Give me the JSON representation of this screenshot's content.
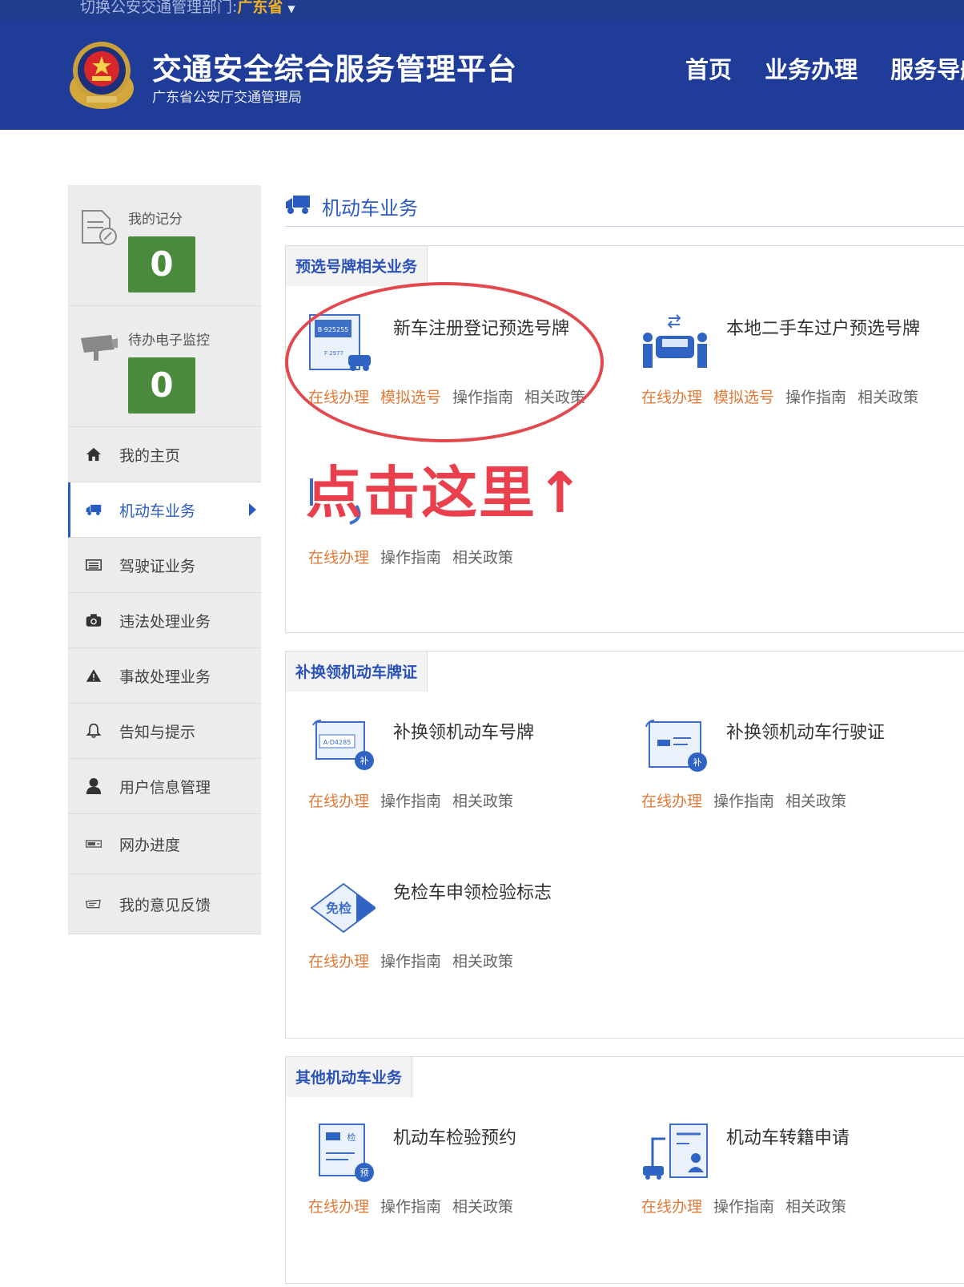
{
  "topbar": {
    "switch_label": "切换公安交通管理部门:",
    "province": "广东省"
  },
  "header": {
    "title": "交通安全综合服务管理平台",
    "subtitle": "广东省公安厅交通管理局",
    "nav": [
      "首页",
      "业务办理",
      "服务导航"
    ]
  },
  "sidebar": {
    "score_label": "我的记分",
    "score_value": "0",
    "monitor_label": "待办电子监控",
    "monitor_value": "0",
    "items": [
      {
        "label": "我的主页",
        "icon": "home-icon"
      },
      {
        "label": "机动车业务",
        "icon": "truck-icon"
      },
      {
        "label": "驾驶证业务",
        "icon": "license-icon"
      },
      {
        "label": "违法处理业务",
        "icon": "camera-icon"
      },
      {
        "label": "事故处理业务",
        "icon": "warning-icon"
      },
      {
        "label": "告知与提示",
        "icon": "bell-icon"
      },
      {
        "label": "用户信息管理",
        "icon": "user-icon"
      },
      {
        "label": "网办进度",
        "icon": "progress-icon"
      },
      {
        "label": "我的意见反馈",
        "icon": "feedback-icon"
      }
    ]
  },
  "main": {
    "title": "机动车业务",
    "sections": [
      {
        "tab": "预选号牌相关业务",
        "services": [
          {
            "name": "新车注册登记预选号牌",
            "links": [
              "在线办理",
              "模拟选号",
              "操作指南",
              "相关政策"
            ]
          },
          {
            "name": "本地二手车过户预选号牌",
            "links": [
              "在线办理",
              "模拟选号",
              "操作指南",
              "相关政策"
            ]
          },
          {
            "name": "",
            "links": [
              "在线办理",
              "操作指南",
              "相关政策"
            ]
          }
        ]
      },
      {
        "tab": "补换领机动车牌证",
        "services": [
          {
            "name": "补换领机动车号牌",
            "links": [
              "在线办理",
              "操作指南",
              "相关政策"
            ]
          },
          {
            "name": "补换领机动车行驶证",
            "links": [
              "在线办理",
              "操作指南",
              "相关政策"
            ]
          },
          {
            "name": "免检车申领检验标志",
            "links": [
              "在线办理",
              "操作指南",
              "相关政策"
            ]
          }
        ]
      },
      {
        "tab": "其他机动车业务",
        "services": [
          {
            "name": "机动车检验预约",
            "links": [
              "在线办理",
              "操作指南",
              "相关政策"
            ]
          },
          {
            "name": "机动车转籍申请",
            "links": [
              "在线办理",
              "操作指南",
              "相关政策"
            ]
          }
        ]
      }
    ]
  },
  "annotation": {
    "text": "点击这里↑",
    "color": "#ea3f4d"
  },
  "colors": {
    "header_bg": "#1f3c99",
    "accent": "#2a5bc1",
    "score_bg": "#4a8a3c",
    "link_hot": "#e07b3a"
  },
  "icons": {
    "plate_text_1": "B·925255",
    "plate_text_2": "F·2977",
    "plate_text_3": "A·D4285",
    "badge_bu": "补",
    "badge_yu": "预",
    "badge_jian": "检",
    "mianjian": "免检"
  }
}
